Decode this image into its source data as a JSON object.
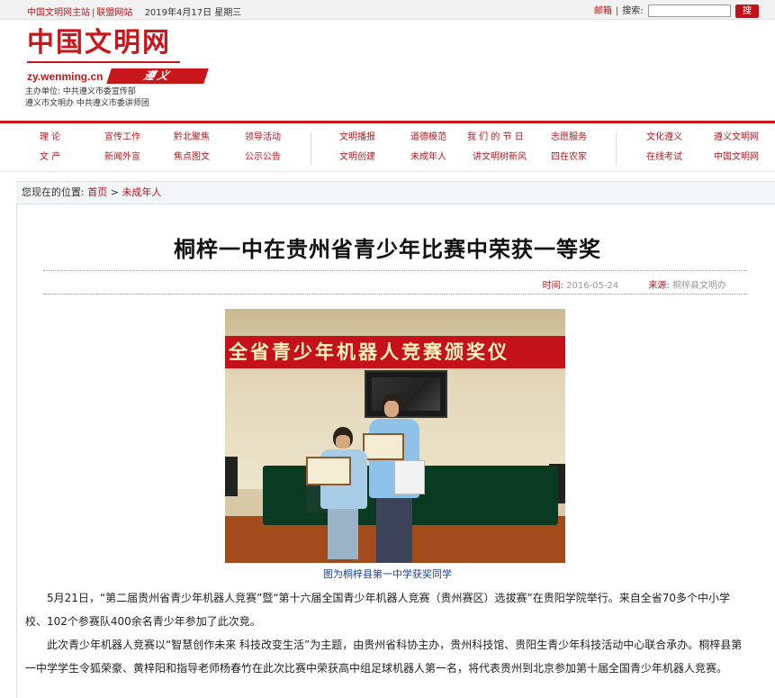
{
  "topbar": {
    "main_site": "中国文明网主站",
    "separator": "|",
    "alliance": "联盟网站",
    "date": "2019年4月17日 星期三",
    "mail": "邮箱",
    "pipe": "|",
    "search_label": "搜索:",
    "search_value": "",
    "search_button": "搜"
  },
  "header": {
    "logo_text": "中国文明网",
    "domain": "zy.wenming.cn",
    "city_seal": "遵义",
    "host_line1": "主办单位: 中共遵义市委宣传部",
    "host_line2": "遵义市文明办 中共遵义市委讲师团"
  },
  "nav": [
    [
      "理  论",
      "文  产"
    ],
    [
      "宣传工作",
      "新闻外宣"
    ],
    [
      "黔北聚焦",
      "焦点图文"
    ],
    [
      "领导活动",
      "公示公告"
    ],
    [
      "文明播报",
      "文明创建"
    ],
    [
      "道德模范",
      "未成年人"
    ],
    [
      "我 们 的 节 日",
      "讲文明树新风"
    ],
    [
      "志愿服务",
      "四在农家"
    ],
    [
      "文化遵义",
      "在线考试"
    ],
    [
      "遵义文明网",
      "中国文明网"
    ]
  ],
  "breadcrumb": {
    "label": "您现在的位置:",
    "home": "首页",
    "arrow": ">",
    "current": "未成年人"
  },
  "article": {
    "title": "桐梓一中在贵州省青少年比赛中荣获一等奖",
    "time_label": "时间:",
    "time": "2016-05-24",
    "source_label": "来源:",
    "source": "桐梓县文明办",
    "photo_banner": "全省青少年机器人竞赛颁奖仪",
    "caption": "图为桐梓县第一中学获奖同学",
    "paragraph1": "5月21日，“第二届贵州省青少年机器人竞赛”暨“第十六届全国青少年机器人竞赛（贵州赛区）选拔赛”在贵阳学院举行。来自全省70多个中小学校、102个参赛队400余名青少年参加了此次竞。",
    "paragraph2": "此次青少年机器人竞赛以“智慧创作未来 科技改变生活”为主题，由贵州省科协主办，贵州科技馆、贵阳生青少年科技活动中心联合承办。桐梓县第一中学学生令狐荣豪、黄梓阳和指导老师杨春竹在此次比赛中荣获高中组足球机器人第一名，将代表贵州到北京参加第十届全国青少年机器人竞赛。"
  }
}
